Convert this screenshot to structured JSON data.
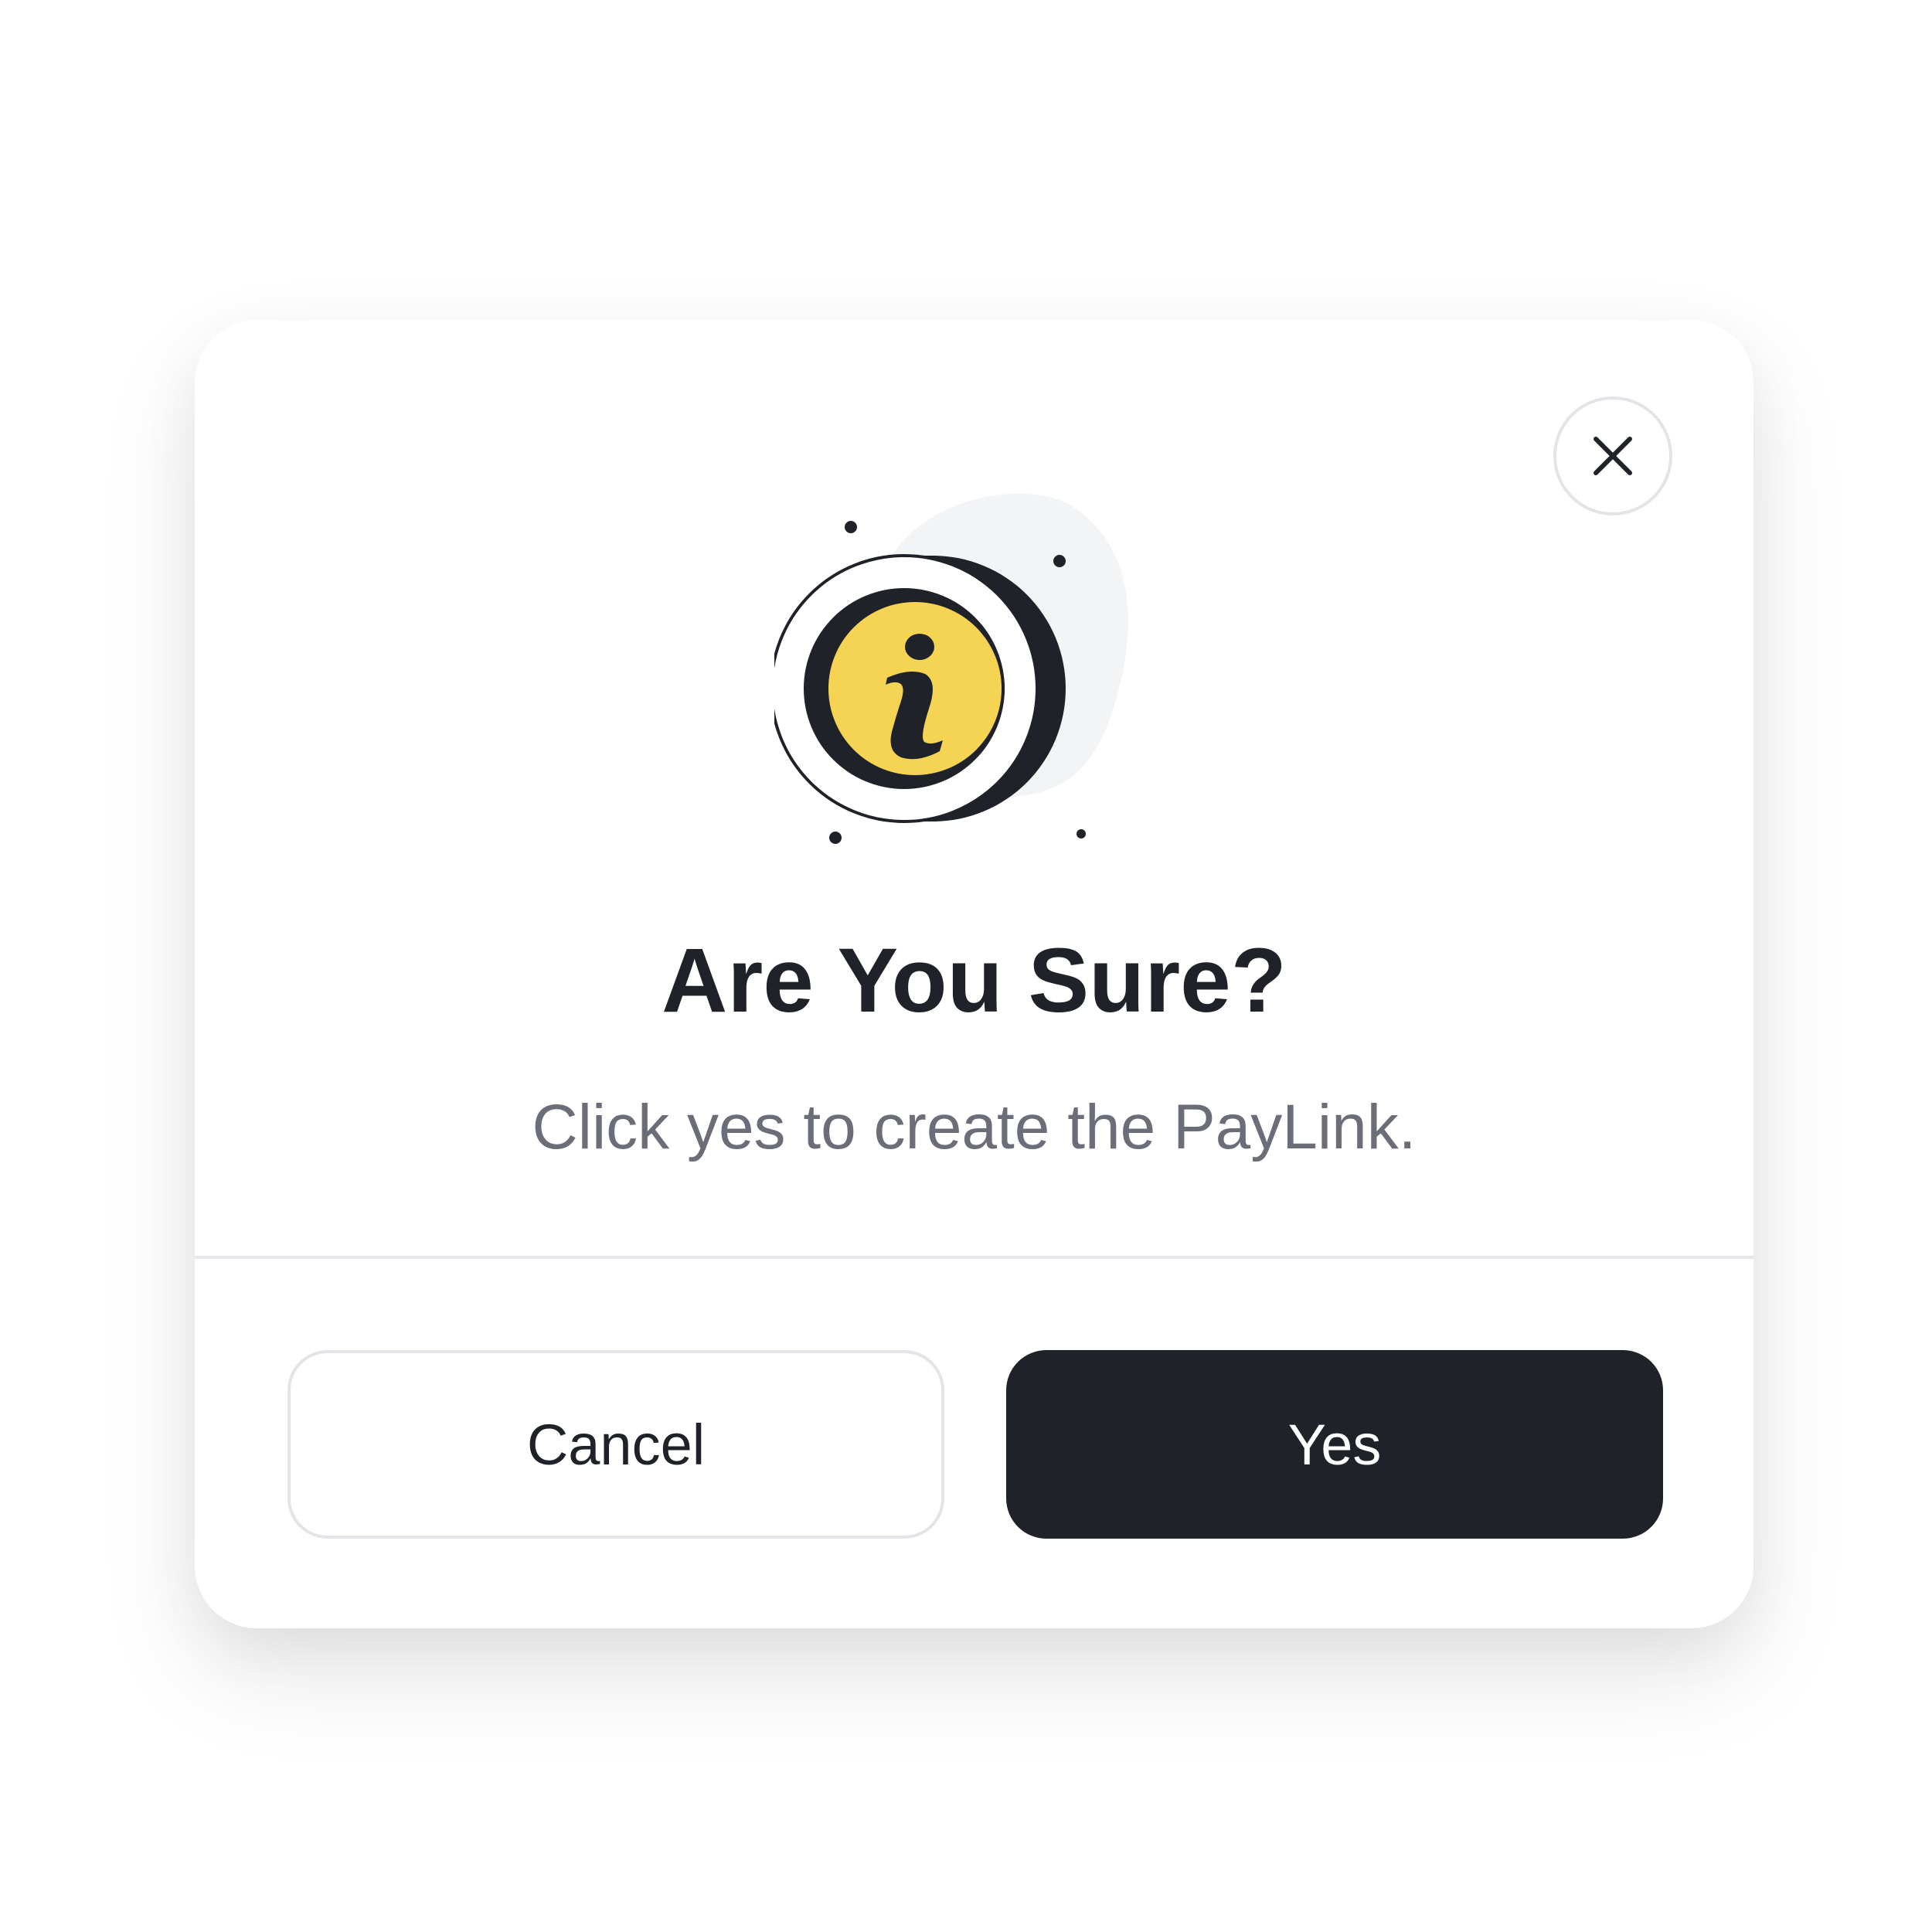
{
  "dialog": {
    "title": "Are You Sure?",
    "message": "Click yes to create the PayLink.",
    "cancel_label": "Cancel",
    "confirm_label": "Yes"
  },
  "icons": {
    "close": "close-icon",
    "hero": "info-icon"
  },
  "colors": {
    "accent_yellow": "#f5d453",
    "dark": "#1f2229",
    "muted_text": "#6b6e78",
    "border": "#e3e4e7",
    "blob": "#f3f4f6"
  }
}
